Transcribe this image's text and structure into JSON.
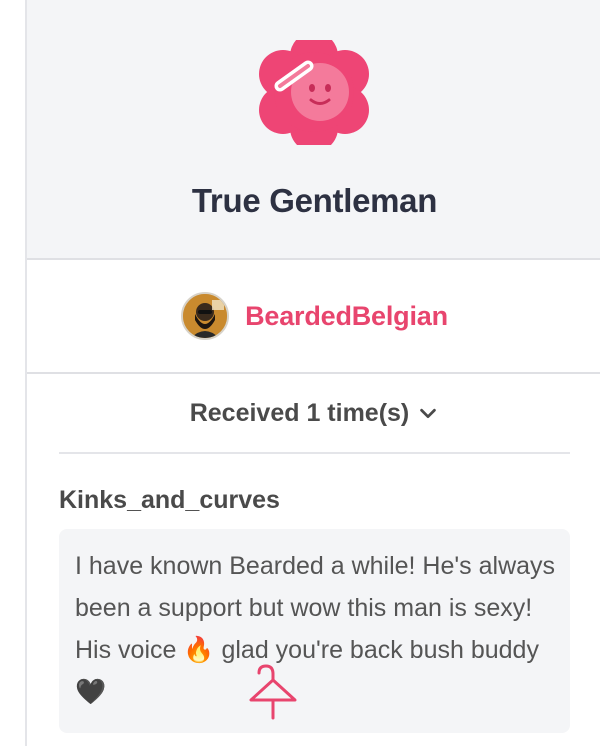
{
  "badge": {
    "title": "True Gentleman",
    "icon": "pink-flower-salute-face-icon",
    "color": "#ee4575"
  },
  "user": {
    "name": "BeardedBelgian",
    "avatar": "bearded-man-avatar"
  },
  "received": {
    "label": "Received 1 time(s)",
    "icon": "chevron-down-icon"
  },
  "review": {
    "author": "Kinks_and_curves",
    "text_before_fire": "I have known Bearded a while! He's always been a support but wow this man is sexy! His voice ",
    "fire_emoji": "🔥",
    "text_after_fire": " glad you're back bush buddy ",
    "heart_emoji": "🖤"
  }
}
